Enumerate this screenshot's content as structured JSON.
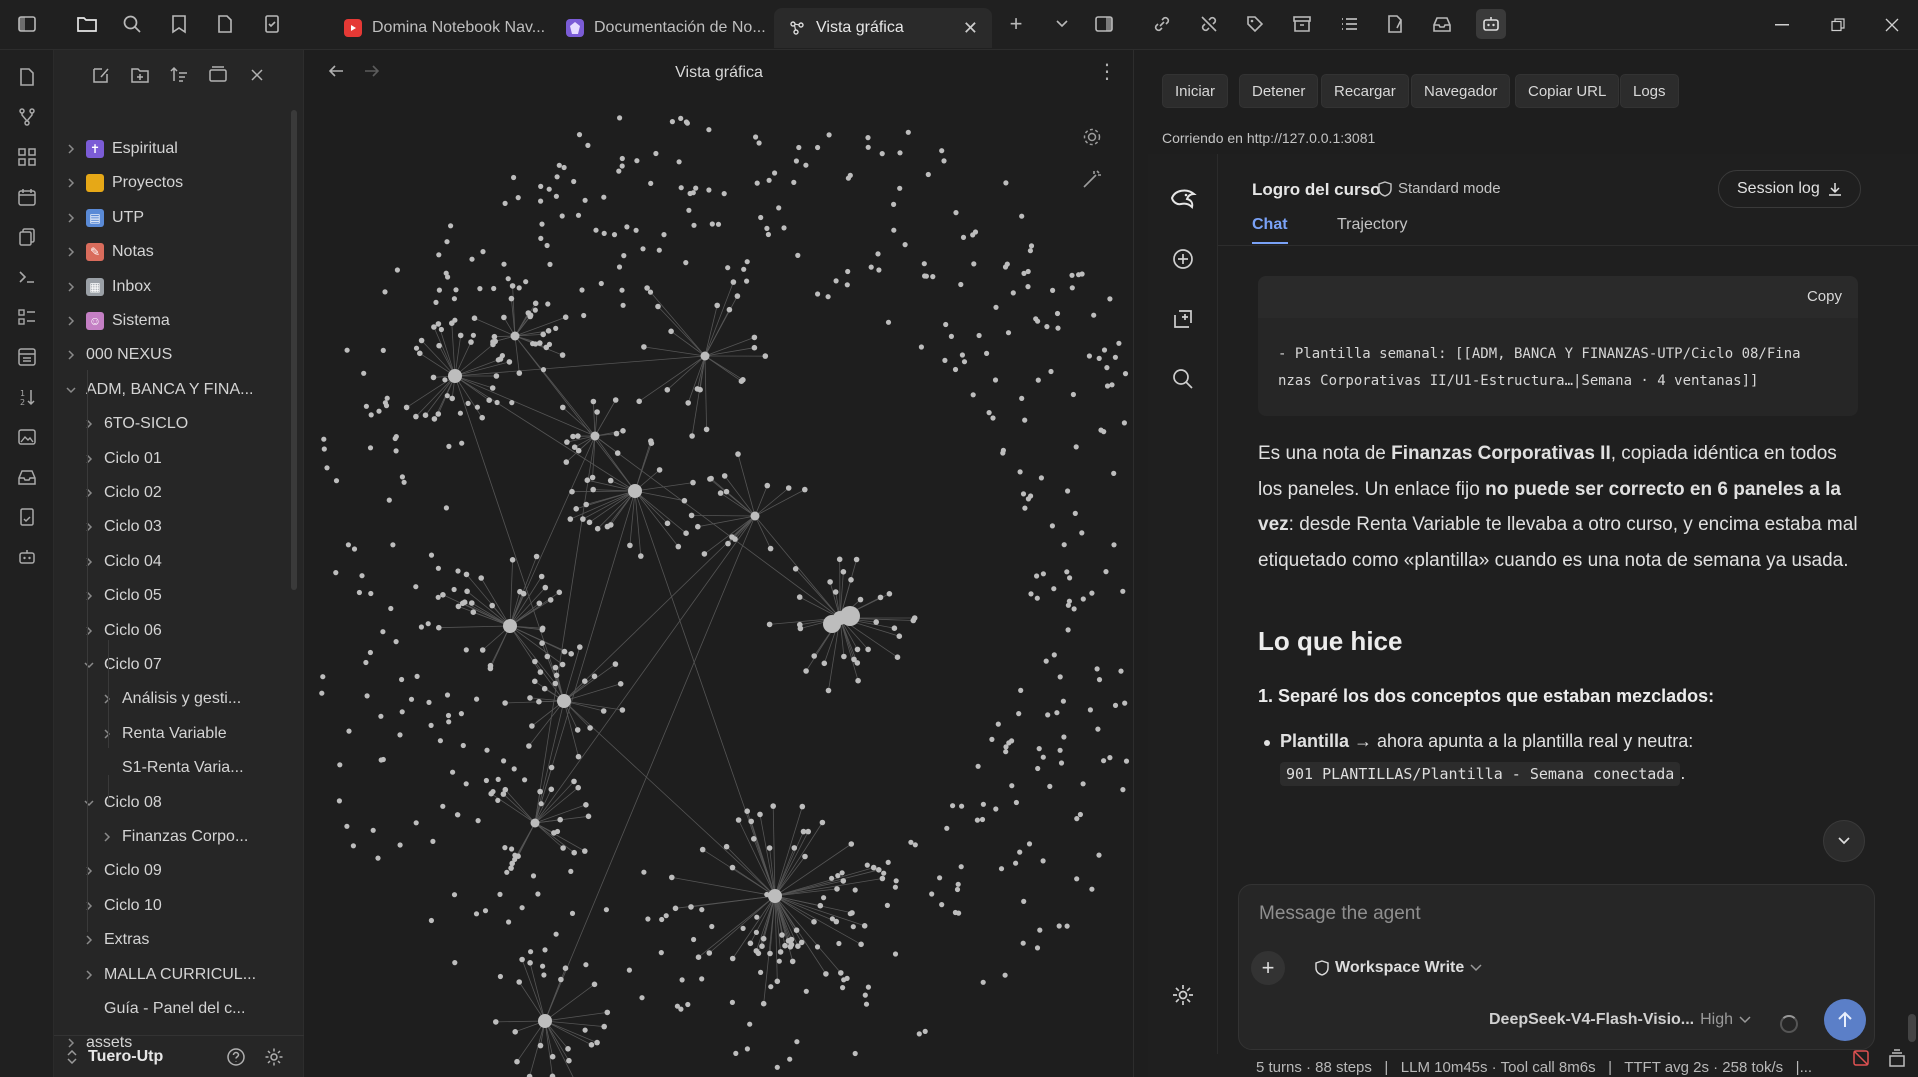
{
  "tabs": [
    {
      "label": "Domina Notebook Nav...",
      "icon": "youtube-icon",
      "active": false
    },
    {
      "label": "Documentación de No...",
      "icon": "obsidian-icon",
      "active": false
    },
    {
      "label": "Vista gráfica",
      "icon": "graph-icon",
      "active": true
    }
  ],
  "explorer": {
    "items": [
      {
        "label": "Espiritual",
        "depth": 0,
        "expanded": false,
        "icon": "cross-icon",
        "icon_color": "#7b5cd6"
      },
      {
        "label": "Proyectos",
        "depth": 0,
        "expanded": false,
        "icon": "folder-icon",
        "icon_color": "#e6a817"
      },
      {
        "label": "UTP",
        "depth": 0,
        "expanded": false,
        "icon": "books-icon",
        "icon_color": "#5a8ad6"
      },
      {
        "label": "Notas",
        "depth": 0,
        "expanded": false,
        "icon": "notes-icon",
        "icon_color": "#d96c5c"
      },
      {
        "label": "Inbox",
        "depth": 0,
        "expanded": false,
        "icon": "inbox-icon",
        "icon_color": "#9aa0a6"
      },
      {
        "label": "Sistema",
        "depth": 0,
        "expanded": false,
        "icon": "robot-icon",
        "icon_color": "#c47fc4"
      },
      {
        "label": "000 NEXUS",
        "depth": 0,
        "expanded": false,
        "icon": "",
        "icon_color": ""
      },
      {
        "label": "ADM, BANCA Y FINA...",
        "depth": 0,
        "expanded": true,
        "icon": "",
        "icon_color": ""
      },
      {
        "label": "6TO-SICLO",
        "depth": 1,
        "expanded": false
      },
      {
        "label": "Ciclo 01",
        "depth": 1,
        "expanded": false
      },
      {
        "label": "Ciclo 02",
        "depth": 1,
        "expanded": false
      },
      {
        "label": "Ciclo 03",
        "depth": 1,
        "expanded": false
      },
      {
        "label": "Ciclo 04",
        "depth": 1,
        "expanded": false
      },
      {
        "label": "Ciclo 05",
        "depth": 1,
        "expanded": false
      },
      {
        "label": "Ciclo 06",
        "depth": 1,
        "expanded": false
      },
      {
        "label": "Ciclo 07",
        "depth": 1,
        "expanded": true
      },
      {
        "label": "Análisis y gesti...",
        "depth": 2,
        "expanded": false
      },
      {
        "label": "Renta Variable",
        "depth": 2,
        "expanded": false
      },
      {
        "label": "S1-Renta Varia...",
        "depth": 2,
        "file": true
      },
      {
        "label": "Ciclo 08",
        "depth": 1,
        "expanded": true
      },
      {
        "label": "Finanzas Corpo...",
        "depth": 2,
        "expanded": false
      },
      {
        "label": "Ciclo 09",
        "depth": 1,
        "expanded": false
      },
      {
        "label": "Ciclo 10",
        "depth": 1,
        "expanded": false
      },
      {
        "label": "Extras",
        "depth": 1,
        "expanded": false
      },
      {
        "label": "MALLA CURRICUL...",
        "depth": 1,
        "expanded": false
      },
      {
        "label": "Guía - Panel del c...",
        "depth": 1,
        "file": true
      },
      {
        "label": "assets",
        "depth": 0,
        "expanded": false
      }
    ],
    "vault_name": "Tuero-Utp"
  },
  "graph": {
    "title": "Vista gráfica"
  },
  "controls": {
    "buttons": [
      "Iniciar",
      "Detener",
      "Recargar",
      "Navegador",
      "Copiar URL",
      "Logs"
    ],
    "status": "Corriendo en http://127.0.0.1:3081"
  },
  "agent": {
    "title": "Logro del curso",
    "mode": "Standard mode",
    "session_log": "Session log",
    "tabs": [
      "Chat",
      "Trajectory"
    ],
    "active_tab": "Chat",
    "code": {
      "copy": "Copy",
      "line1": "- Plantilla semanal: [[ADM, BANCA Y FINANZAS-UTP/Ciclo 08/Fina",
      "line2": "nzas Corporativas II/U1-Estructura…|Semana · 4 ventanas]]"
    },
    "para": {
      "p1": "Es una nota de ",
      "b1": "Finanzas Corporativas II",
      "p2": ", copiada idéntica en todos los paneles. Un enlace fijo ",
      "b2": "no puede ser correcto en 6 paneles a la vez",
      "p3": ": desde Renta Variable te llevaba a otro curso, y encima estaba mal etiquetado como «plantilla» cuando es una nota de semana ya usada."
    },
    "heading": "Lo que hice",
    "step1": "1. Separé los dos conceptos que estaban mezclados:",
    "bullet_bold": "Plantilla",
    "bullet_text": " → ahora apunta a la plantilla real y neutra:",
    "bullet_code": "901 PLANTILLAS/Plantilla - Semana conectada",
    "bullet_tail": ".",
    "composer": {
      "placeholder": "Message the agent",
      "workspace": "Workspace Write",
      "model": "DeepSeek-V4-Flash-Visio...",
      "effort": "High"
    },
    "stats": "5 turns · 88 steps   |   LLM 10m45s · Tool call 8m6s   |   TTFT avg 2s · 258 tok/s   |..."
  },
  "colors": {
    "accent": "#7aa2f7",
    "send_button": "#5b7fc8",
    "node": "#bdbdbd",
    "edge": "#555555"
  }
}
